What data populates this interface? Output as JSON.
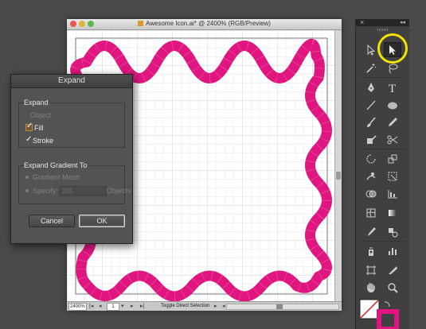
{
  "document": {
    "title": "Awesome Icon.ai* @ 2400% (RGB/Preview)",
    "zoom": "2400%",
    "page": "1",
    "status": "Toggle Direct Selection"
  },
  "dialog": {
    "title": "Expand",
    "expand_group": {
      "label": "Expand",
      "object": "Object",
      "fill": "Fill",
      "stroke": "Stroke"
    },
    "gradient_group": {
      "label": "Expand Gradient To",
      "gradient_mesh": "Gradient Mesh",
      "specify": "Specify:",
      "specify_value": "255",
      "objects": "Objects"
    },
    "cancel_label": "Cancel",
    "ok_label": "OK"
  },
  "tools_panel": {
    "close_glyph": "×",
    "collapse_glyph": "◂◂",
    "tools": [
      "selection-tool",
      "direct-selection-tool",
      "magic-wand-tool",
      "lasso-tool",
      "pen-tool",
      "type-tool",
      "line-segment-tool",
      "ellipse-tool",
      "paintbrush-tool",
      "pencil-tool",
      "blob-brush-tool",
      "scissors-tool",
      "rotate-tool",
      "scale-tool",
      "warp-tool",
      "free-transform-tool",
      "shape-builder-tool",
      "graph-tool",
      "mesh-tool",
      "gradient-tool",
      "eyedropper-tool",
      "blend-tool",
      "symbol-sprayer-tool",
      "column-graph-tool",
      "artboard-tool",
      "slice-tool",
      "hand-tool",
      "zoom-tool"
    ]
  },
  "colors": {
    "wave_stroke": "#e0157f",
    "highlight": "#f2e200",
    "stroke_swatch": "#e0157f"
  }
}
